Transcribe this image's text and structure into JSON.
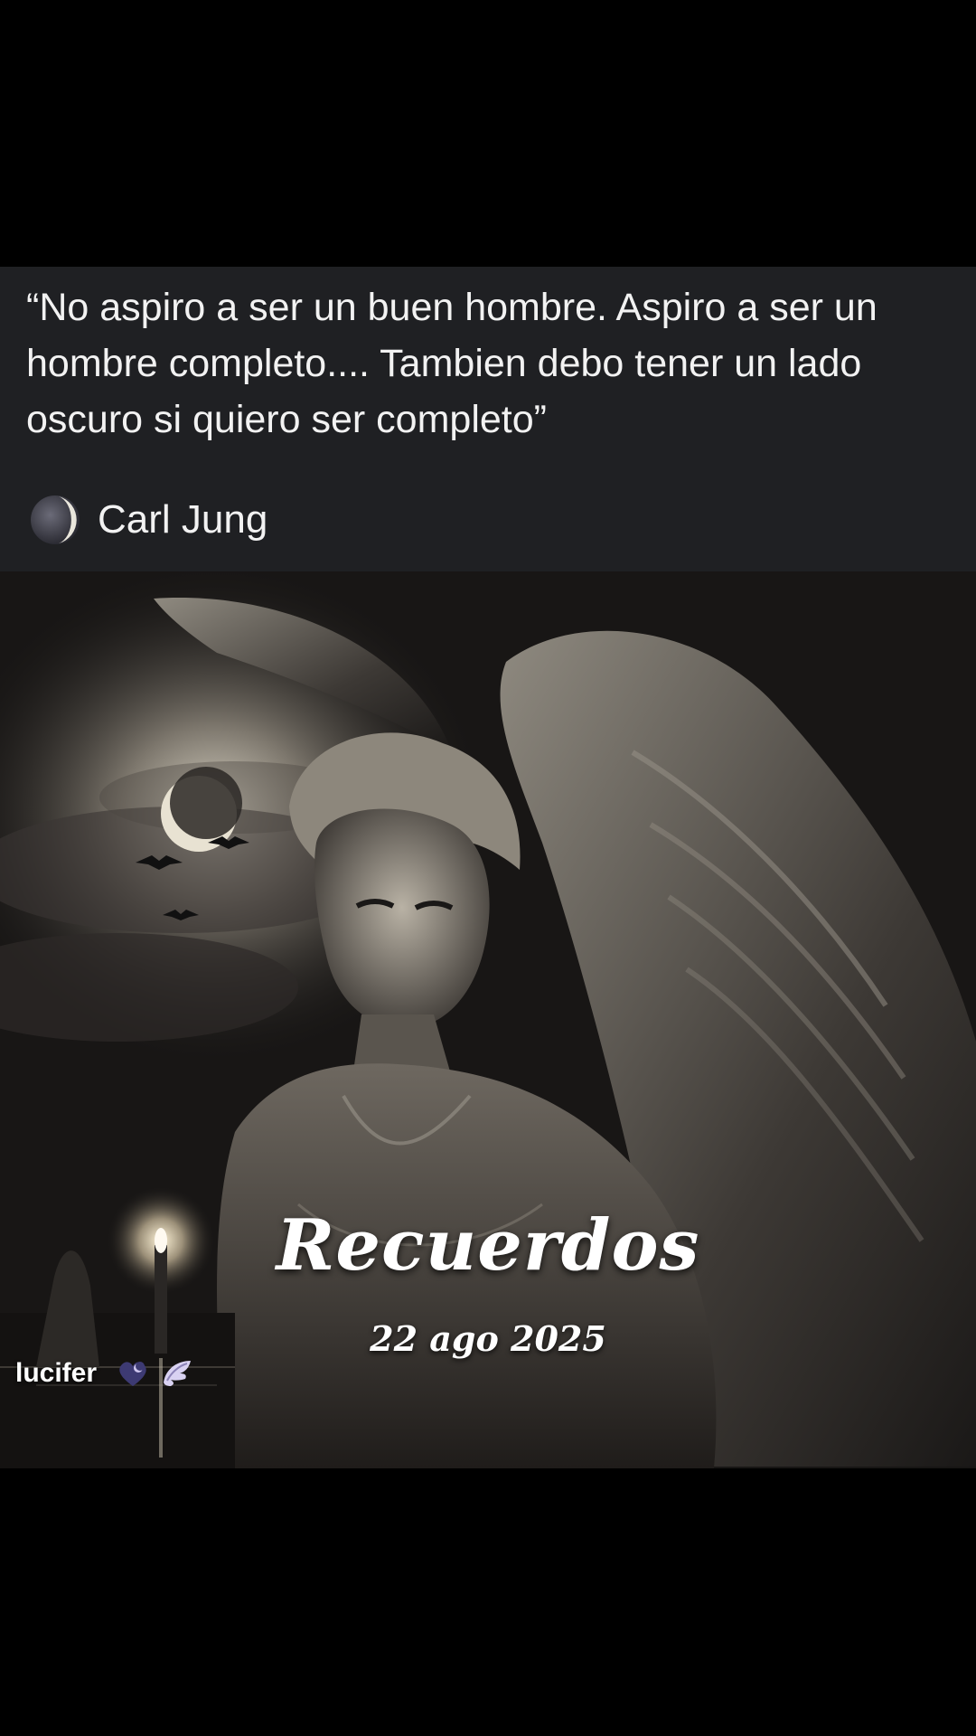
{
  "post": {
    "quote_text": "“No aspiro a ser un buen hombre. Aspiro a ser un hombre completo.... Tambien debo tener un lado oscuro si quiero ser completo”",
    "author_icon": "moon-icon",
    "author": "Carl Jung"
  },
  "memory": {
    "title": "Recuerdos",
    "date": "22 ago 2025",
    "username": "lucifer",
    "badge_icons": [
      "heart-moon-icon",
      "wing-icon"
    ]
  },
  "colors": {
    "background": "#000000",
    "card_background": "#1f2023",
    "text": "#f2f2f2"
  }
}
